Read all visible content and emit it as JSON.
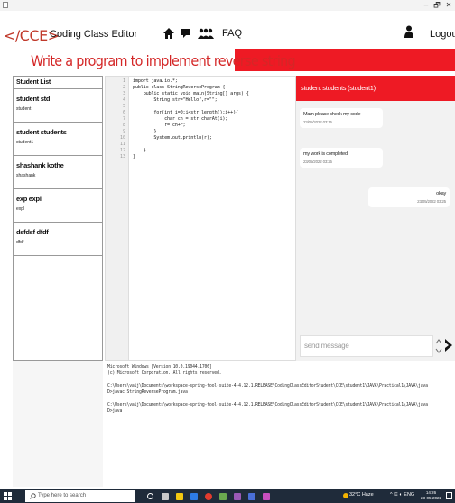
{
  "window": {
    "min": "–",
    "max": "🗗",
    "close": "✕"
  },
  "header": {
    "logo": "</CCE>",
    "title": "Coding Class Editor",
    "faq": "FAQ",
    "logout": "Logout"
  },
  "problem": "Write a program to implement reverse string",
  "students": {
    "header": "Student List",
    "items": [
      {
        "name": "student std",
        "id": "student"
      },
      {
        "name": "student students",
        "id": "student1"
      },
      {
        "name": "shashank kothe",
        "id": "shashank"
      },
      {
        "name": "exp expl",
        "id": "expl"
      },
      {
        "name": "dsfdsf dfdf",
        "id": "dfdf"
      }
    ]
  },
  "editor": {
    "lines": [
      "1",
      "2",
      "3",
      "4",
      "5",
      "6",
      "7",
      "8",
      "9",
      "10",
      "11",
      "12",
      "13"
    ],
    "code": [
      "import java.io.*;",
      "public class StringReverseProgram {",
      "    public static void main(String[] args) {",
      "        String str=\"Hello\",r=\"\";",
      "",
      "        for(int i=0;i<str.length();i++){",
      "            char ch = str.charAt(i);",
      "            r= ch+r;",
      "        }",
      "        System.out.println(r);",
      "",
      "    }",
      "}"
    ]
  },
  "chat": {
    "title": "student students (student1)",
    "messages": [
      {
        "text": "Mam please check my code",
        "time": "23/05/2022 03:15"
      },
      {
        "text": "my work is completed",
        "time": "23/05/2022 03:25"
      },
      {
        "text": "okay",
        "time": "23/05/2022 03:25"
      }
    ],
    "placeholder": "send message"
  },
  "console": {
    "lines": [
      "Microsoft Windows [Version 10.0.19044.1706]",
      "(c) Microsoft Corporation. All rights reserved.",
      "",
      "C:\\Users\\vaij\\Documents\\workspace-spring-tool-suite-4-4.12.1.RELEASE\\CodingClassEditorStudent\\CCE\\student1\\JAVA\\Practical1\\JAVA\\java",
      "D>javac StringReverseProgram.java",
      "",
      "C:\\Users\\vaij\\Documents\\workspace-spring-tool-suite-4-4.12.1.RELEASE\\CodingClassEditorStudent\\CCE\\student1\\JAVA\\Practical1\\JAVA\\java",
      "D>java"
    ]
  },
  "taskbar": {
    "search": "Type here to search",
    "weather": "32°C Haze",
    "tray": "^ ⋿ ◐ ENG",
    "time": "14:26",
    "date": "23-05-2022"
  },
  "colors": {
    "accent": "#ee1a24",
    "logo": "#c0392b"
  }
}
